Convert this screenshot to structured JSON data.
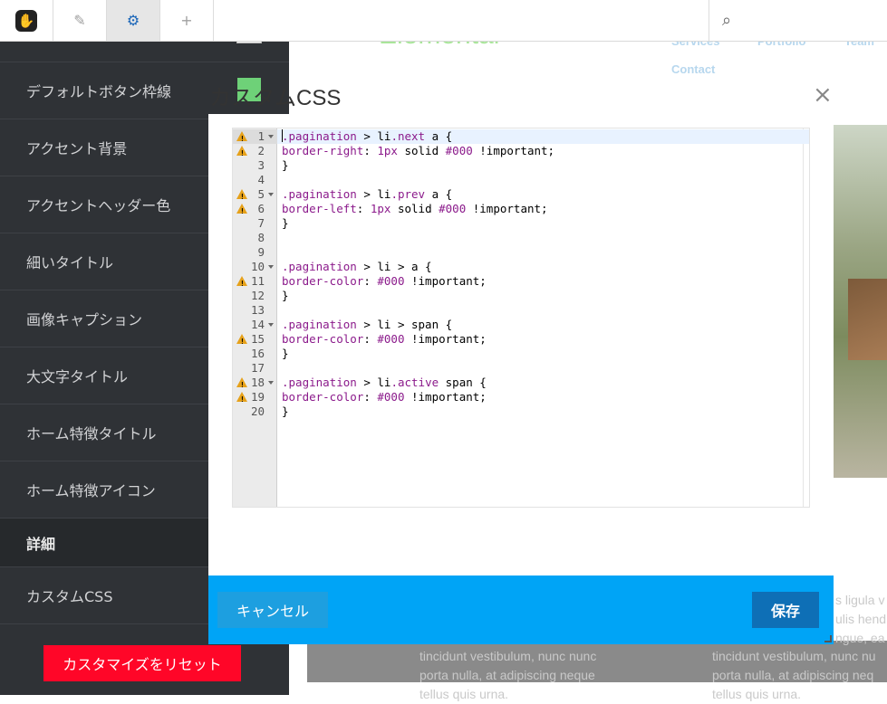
{
  "toolbar": {
    "logo": "✋",
    "edit_icon": "✎",
    "settings_icon": "⚙",
    "add_icon": "+",
    "search_icon": "⌕"
  },
  "sidebar": {
    "items": [
      {
        "label": "デフォルトボタン枠線"
      },
      {
        "label": "アクセント背景"
      },
      {
        "label": "アクセントヘッダー色"
      },
      {
        "label": "細いタイトル"
      },
      {
        "label": "画像キャプション"
      },
      {
        "label": "大文字タイトル"
      },
      {
        "label": "ホーム特徴タイトル"
      },
      {
        "label": "ホーム特徴アイコン"
      }
    ],
    "section_label": "詳細",
    "custom_css_label": "カスタムCSS",
    "reset_label": "カスタマイズをリセット"
  },
  "site": {
    "title": "Elemental",
    "nav": [
      "Services",
      "Portfolio",
      "Team",
      "Contact"
    ],
    "text_left": [
      "tincidunt vestibulum, nunc nunc",
      "porta nulla, at adipiscing neque",
      "tellus quis urna."
    ],
    "text_right": [
      "s ligula v",
      "ulis hend",
      "ngue, ea",
      "tincidunt vestibulum, nunc nu",
      "porta nulla, at adipiscing neq",
      "tellus quis urna."
    ]
  },
  "modal": {
    "title": "カスタムCSS",
    "close_icon": "×",
    "cancel_label": "キャンセル",
    "save_label": "保存",
    "code_lines": [
      {
        "n": "1",
        "warn": true,
        "fold": true,
        "text": ".pagination > li.next a {"
      },
      {
        "n": "2",
        "warn": true,
        "fold": false,
        "text": "border-right: 1px solid #000 !important;"
      },
      {
        "n": "3",
        "warn": false,
        "fold": false,
        "text": "}"
      },
      {
        "n": "4",
        "warn": false,
        "fold": false,
        "text": ""
      },
      {
        "n": "5",
        "warn": true,
        "fold": true,
        "text": ".pagination > li.prev a {"
      },
      {
        "n": "6",
        "warn": true,
        "fold": false,
        "text": "border-left: 1px solid #000 !important;"
      },
      {
        "n": "7",
        "warn": false,
        "fold": false,
        "text": "}"
      },
      {
        "n": "8",
        "warn": false,
        "fold": false,
        "text": ""
      },
      {
        "n": "9",
        "warn": false,
        "fold": false,
        "text": ""
      },
      {
        "n": "10",
        "warn": false,
        "fold": true,
        "text": ".pagination > li > a {"
      },
      {
        "n": "11",
        "warn": true,
        "fold": false,
        "text": "border-color: #000 !important;"
      },
      {
        "n": "12",
        "warn": false,
        "fold": false,
        "text": "}"
      },
      {
        "n": "13",
        "warn": false,
        "fold": false,
        "text": ""
      },
      {
        "n": "14",
        "warn": false,
        "fold": true,
        "text": ".pagination > li > span {"
      },
      {
        "n": "15",
        "warn": true,
        "fold": false,
        "text": "border-color: #000 !important;"
      },
      {
        "n": "16",
        "warn": false,
        "fold": false,
        "text": "}"
      },
      {
        "n": "17",
        "warn": false,
        "fold": false,
        "text": ""
      },
      {
        "n": "18",
        "warn": true,
        "fold": true,
        "text": ".pagination > li.active span {"
      },
      {
        "n": "19",
        "warn": true,
        "fold": false,
        "text": "border-color: #000 !important;"
      },
      {
        "n": "20",
        "warn": false,
        "fold": false,
        "text": "}"
      }
    ]
  },
  "colors": {
    "footer": "#00a4f6",
    "save": "#0e6fb6",
    "reset": "#ff0628",
    "sidebar": "#2f3236"
  }
}
